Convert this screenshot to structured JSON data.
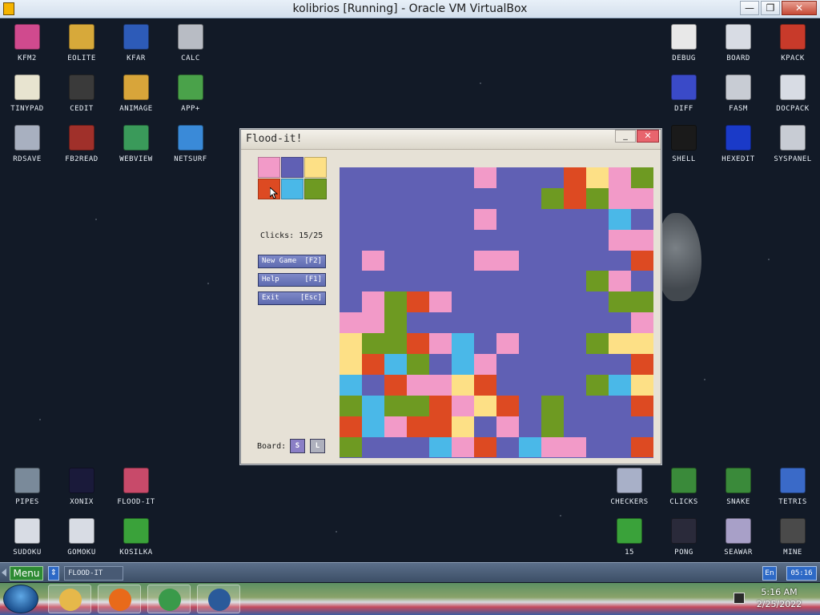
{
  "host_window": {
    "title": "kolibrios [Running] - Oracle VM VirtualBox",
    "minimize": "—",
    "maximize": "❐",
    "close": "✕"
  },
  "desktop_icons": {
    "left": [
      {
        "label": "KFM2",
        "icon": "floppy-icon",
        "color": "#d04a8e"
      },
      {
        "label": "EOLITE",
        "icon": "folder-icon",
        "color": "#d7a93a"
      },
      {
        "label": "KFAR",
        "icon": "kfar-icon",
        "color": "#2d5bb8"
      },
      {
        "label": "CALC",
        "icon": "calculator-icon",
        "color": "#b8bcc4"
      },
      {
        "label": "TINYPAD",
        "icon": "notepad-icon",
        "color": "#e8e4d0"
      },
      {
        "label": "CEDIT",
        "icon": "code-icon",
        "color": "#3a3a3a"
      },
      {
        "label": "ANIMAGE",
        "icon": "pencil-icon",
        "color": "#d8a53a"
      },
      {
        "label": "APP+",
        "icon": "cube-icon",
        "color": "#4aa24a"
      },
      {
        "label": "RDSAVE",
        "icon": "rdsave-icon",
        "color": "#a8b0c0"
      },
      {
        "label": "FB2READ",
        "icon": "book-icon",
        "color": "#a0302a"
      },
      {
        "label": "WEBVIEW",
        "icon": "webview-icon",
        "color": "#3a9a5a"
      },
      {
        "label": "NETSURF",
        "icon": "globe-icon",
        "color": "#3a8ad8"
      }
    ],
    "right": [
      {
        "label": "DEBUG",
        "icon": "debug-icon",
        "color": "#e8e8e8"
      },
      {
        "label": "BOARD",
        "icon": "board-icon",
        "color": "#d8dce4"
      },
      {
        "label": "KPACK",
        "icon": "wrench-icon",
        "color": "#c83a2a"
      },
      {
        "label": "DIFF",
        "icon": "diff-icon",
        "color": "#3a4ac8"
      },
      {
        "label": "FASM",
        "icon": "fasm-icon",
        "color": "#c8ccd4"
      },
      {
        "label": "DOCPACK",
        "icon": "docpack-icon",
        "color": "#d8dce4"
      },
      {
        "label": "SHELL",
        "icon": "terminal-icon",
        "color": "#1a1a1a"
      },
      {
        "label": "HEXEDIT",
        "icon": "hex-icon",
        "color": "#1a3ac8"
      },
      {
        "label": "SYSPANEL",
        "icon": "syspanel-icon",
        "color": "#c8ccd4"
      }
    ],
    "bottom_left": [
      {
        "label": "PIPES",
        "icon": "pipes-icon",
        "color": "#7a8a9a"
      },
      {
        "label": "XONIX",
        "icon": "xonix-icon",
        "color": "#1a1a3a"
      },
      {
        "label": "FLOOD-IT",
        "icon": "flood-it-icon",
        "color": "#c84a6a"
      },
      {
        "label": "SUDOKU",
        "icon": "sudoku-icon",
        "color": "#d8dce4"
      },
      {
        "label": "GOMOKU",
        "icon": "gomoku-icon",
        "color": "#d8dce4"
      },
      {
        "label": "KOSILKA",
        "icon": "lawnmower-icon",
        "color": "#3aa23a"
      }
    ],
    "bottom_right": [
      {
        "label": "CHECKERS",
        "icon": "checkers-icon",
        "color": "#a8b0c8"
      },
      {
        "label": "CLICKS",
        "icon": "clicks-icon",
        "color": "#3a8a3a"
      },
      {
        "label": "SNAKE",
        "icon": "snake-icon",
        "color": "#3a8a3a"
      },
      {
        "label": "TETRIS",
        "icon": "tetris-icon",
        "color": "#3a6ac8"
      },
      {
        "label": "15",
        "icon": "fifteen-icon",
        "color": "#3aa23a"
      },
      {
        "label": "PONG",
        "icon": "pong-icon",
        "color": "#2a2a3a"
      },
      {
        "label": "SEAWAR",
        "icon": "seawar-icon",
        "color": "#a8a0c8"
      },
      {
        "label": "MINE",
        "icon": "mine-icon",
        "color": "#4a4a4a"
      }
    ]
  },
  "flood_it": {
    "title": "Flood-it!",
    "minimize": "_",
    "close": "✕",
    "palette": [
      "#f29ac8",
      "#6060b4",
      "#fde086",
      "#dd4a22",
      "#4ab8e8",
      "#6e9a22"
    ],
    "clicks_label": "Clicks: 15/25",
    "buttons": {
      "new_game": {
        "label": "New Game",
        "key": "[F2]"
      },
      "help": {
        "label": "Help",
        "key": "[F1]"
      },
      "exit": {
        "label": "Exit",
        "key": "[Esc]"
      }
    },
    "board_label": "Board:",
    "board_small": "S",
    "board_large": "L",
    "board": [
      "BBBBBBPBBBRYPG",
      "BBBBBBBBBGRGPP",
      "BBBBBBPBBBBBCB",
      "BBBBBBBBBBBBPP",
      "BPBBBBPPBBBBBR",
      "BBBBBBBBBBBGPB",
      "BPGRPBBBBBBBGG",
      "PPGBBBBBBBBBBP",
      "YGGRPCBPBBBGYY",
      "YRCGBCPBBBBBBR",
      "CBRPPYRBBBBGCY",
      "GCGGRPYRBGBBBR",
      "RCPRRYBPBGBBBB",
      "GBBBCPRBCPPBBR"
    ],
    "colors": {
      "B": "#6060b4",
      "P": "#f29ac8",
      "G": "#6e9a22",
      "R": "#dd4a22",
      "Y": "#fde086",
      "C": "#4ab8e8"
    }
  },
  "kos_taskbar": {
    "menu": "Menu",
    "switch": "⇕",
    "task": "FLOOD-IT",
    "lang": "En",
    "clock": "05:16"
  },
  "win_taskbar": {
    "apps": [
      {
        "name": "explorer",
        "icon": "folder-icon",
        "color": "#e6b84a"
      },
      {
        "name": "firefox",
        "icon": "firefox-icon",
        "color": "#e86a1a"
      },
      {
        "name": "chrome",
        "icon": "chrome-icon",
        "color": "#3a9a4a"
      },
      {
        "name": "virtualbox",
        "icon": "virtualbox-icon",
        "color": "#2a5a9a"
      }
    ],
    "time": "5:16 AM",
    "date": "2/25/2022"
  }
}
